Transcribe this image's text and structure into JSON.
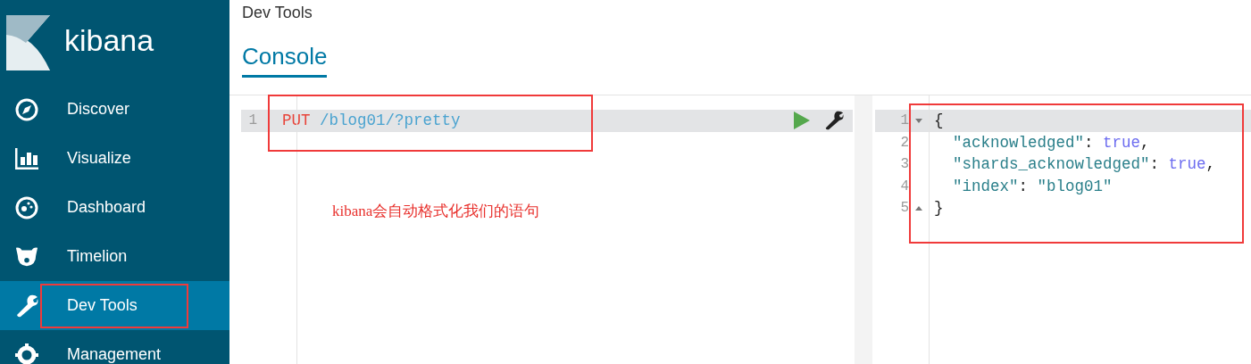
{
  "sidebar": {
    "brand": "kibana",
    "items": [
      {
        "label": "Discover",
        "selected": false
      },
      {
        "label": "Visualize",
        "selected": false
      },
      {
        "label": "Dashboard",
        "selected": false
      },
      {
        "label": "Timelion",
        "selected": false
      },
      {
        "label": "Dev Tools",
        "selected": true
      },
      {
        "label": "Management",
        "selected": false
      }
    ]
  },
  "page_title": "Dev Tools",
  "tabs": [
    {
      "label": "Console",
      "selected": true
    }
  ],
  "request_editor": {
    "lines": [
      {
        "number": "1",
        "active": true,
        "tokens": [
          {
            "kind": "method",
            "text": "PUT"
          },
          {
            "kind": "url",
            "text": " /blog01/?pretty"
          }
        ]
      }
    ]
  },
  "response_editor": {
    "lines": [
      {
        "number": "1",
        "active": true,
        "kind": "open",
        "tokens": [
          {
            "kind": "punct",
            "text": "{"
          }
        ]
      },
      {
        "number": "2",
        "active": false,
        "kind": "member",
        "tokens": [
          {
            "kind": "key",
            "text": "\"acknowledged\""
          },
          {
            "kind": "punct",
            "text": ": "
          },
          {
            "kind": "bool",
            "text": "true"
          },
          {
            "kind": "punct",
            "text": ","
          }
        ]
      },
      {
        "number": "3",
        "active": false,
        "kind": "member",
        "tokens": [
          {
            "kind": "key",
            "text": "\"shards_acknowledged\""
          },
          {
            "kind": "punct",
            "text": ": "
          },
          {
            "kind": "bool",
            "text": "true"
          },
          {
            "kind": "punct",
            "text": ","
          }
        ]
      },
      {
        "number": "4",
        "active": false,
        "kind": "member",
        "tokens": [
          {
            "kind": "key",
            "text": "\"index\""
          },
          {
            "kind": "punct",
            "text": ": "
          },
          {
            "kind": "string",
            "text": "\"blog01\""
          }
        ]
      },
      {
        "number": "5",
        "active": false,
        "kind": "close",
        "tokens": [
          {
            "kind": "punct",
            "text": "}"
          }
        ]
      }
    ]
  },
  "annotation": {
    "note": "kibana会自动格式化我们的语句"
  }
}
